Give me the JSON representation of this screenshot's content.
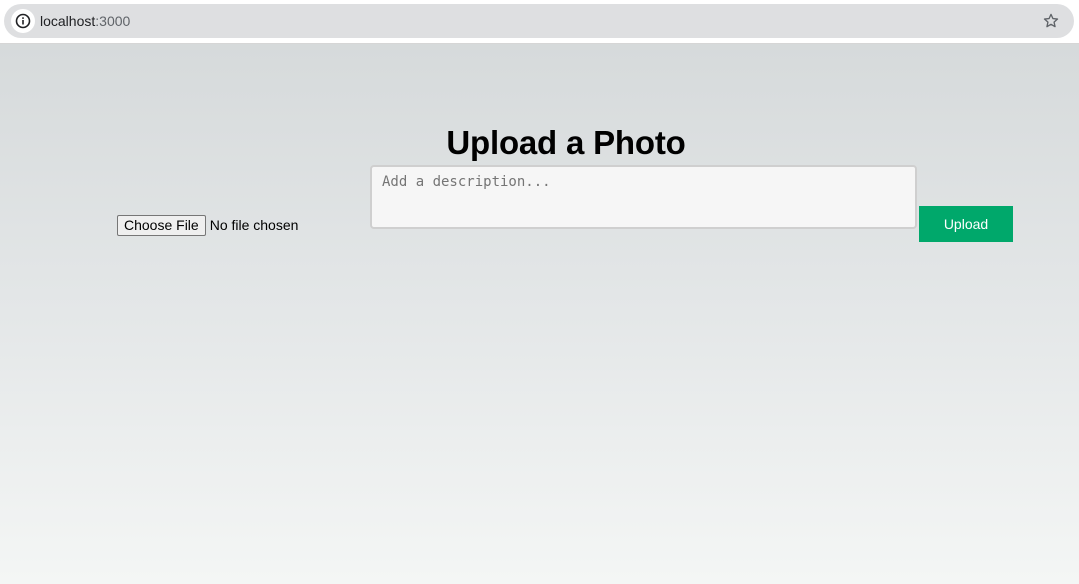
{
  "browser": {
    "url_host": "localhost",
    "url_port": ":3000",
    "icons": {
      "site_info": "info-icon",
      "bookmark": "star-icon"
    }
  },
  "page": {
    "title": "Upload a Photo",
    "file_input": {
      "button_label": "Choose File",
      "status": "No file chosen"
    },
    "description": {
      "placeholder": "Add a description...",
      "value": ""
    },
    "upload_button_label": "Upload",
    "colors": {
      "upload_button": "#00a86b",
      "background_top": "#d6dadb",
      "background_bottom": "#f4f6f5"
    }
  }
}
